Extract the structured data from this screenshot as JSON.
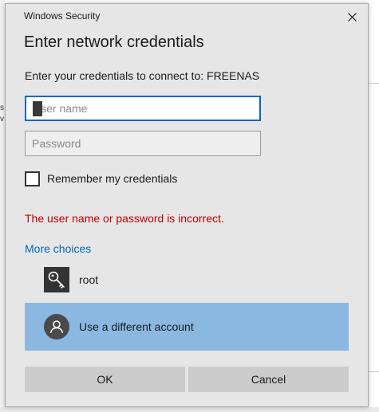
{
  "window": {
    "title": "Windows Security"
  },
  "dialog": {
    "heading": "Enter network credentials",
    "prompt": "Enter your credentials to connect to: FREENAS"
  },
  "form": {
    "username": {
      "value": "",
      "placeholder": "User name"
    },
    "password": {
      "value": "",
      "placeholder": "Password"
    },
    "remember": {
      "label": "Remember my credentials",
      "checked": false
    }
  },
  "error_message": "The user name or password is incorrect.",
  "more_choices_label": "More choices",
  "accounts": [
    {
      "label": "root",
      "icon": "key-icon"
    },
    {
      "label": "Use a different account",
      "icon": "person-icon",
      "selected": true
    }
  ],
  "buttons": {
    "ok": "OK",
    "cancel": "Cancel"
  },
  "colors": {
    "dialog_bg": "#e6e6e6",
    "accent": "#0067c0",
    "error": "#c00000",
    "selected_row": "#8ab8e0",
    "button_bg": "#cccccc"
  }
}
